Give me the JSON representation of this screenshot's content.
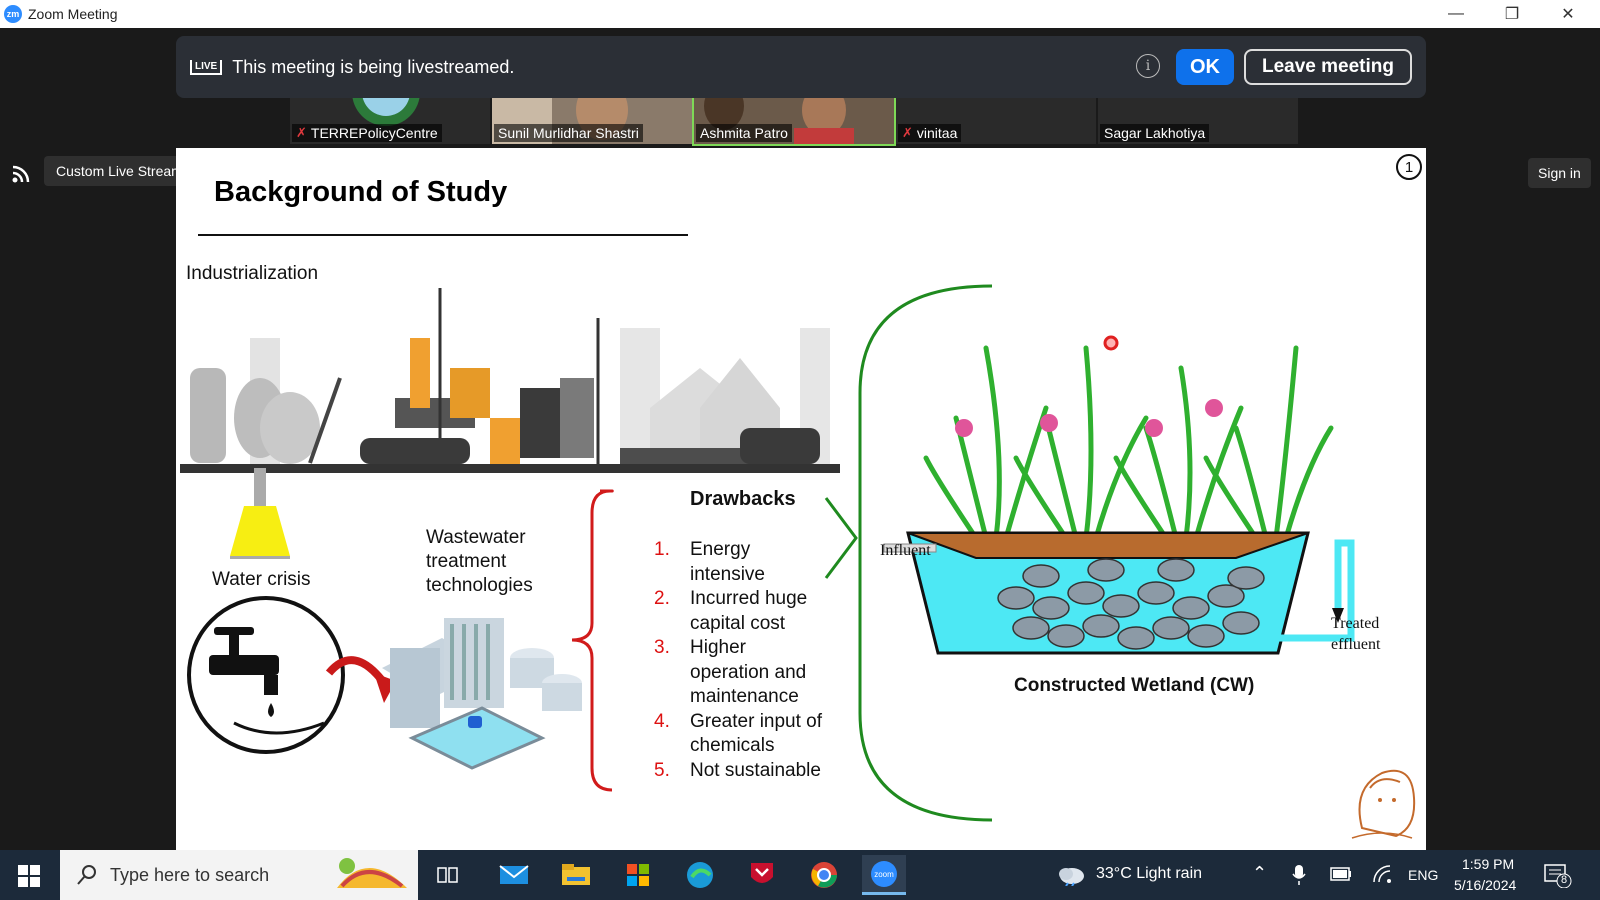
{
  "window": {
    "logo": "zm",
    "title": "Zoom Meeting",
    "controls": [
      "minimize-icon",
      "restore-icon",
      "close-icon"
    ]
  },
  "banner": {
    "live_badge": "LIVE",
    "text": "This meeting is being livestreamed.",
    "ok_label": "OK",
    "leave_label": "Leave meeting"
  },
  "participants": [
    {
      "name": "TERREPolicyCentre",
      "muted": true
    },
    {
      "name": "Sunil Murlidhar Shastri",
      "muted": false
    },
    {
      "name": "Ashmita Patro",
      "muted": false,
      "active": true
    },
    {
      "name": "vinitaa",
      "muted": true
    },
    {
      "name": "Sagar Lakhotiya",
      "muted": false
    }
  ],
  "streaming": {
    "label": "Custom Live Streaming Service",
    "sign_in": "Sign in"
  },
  "slide": {
    "number": "1",
    "title": "Background of Study",
    "industrialization": "Industrialization",
    "water_crisis": "Water crisis",
    "wastewater": [
      "Wastewater",
      "treatment",
      "technologies"
    ],
    "drawbacks_title": "Drawbacks",
    "drawbacks": [
      {
        "num": "1.",
        "lines": [
          "Energy",
          "intensive"
        ]
      },
      {
        "num": "2.",
        "lines": [
          "Incurred huge",
          "capital cost"
        ]
      },
      {
        "num": "3.",
        "lines": [
          "Higher",
          "operation and",
          "maintenance"
        ]
      },
      {
        "num": "4.",
        "lines": [
          "Greater input of",
          "chemicals"
        ]
      },
      {
        "num": "5.",
        "lines": [
          "Not sustainable"
        ]
      }
    ],
    "influent": "Influent",
    "treated": [
      "Treated",
      "effluent"
    ],
    "cw_label": "Constructed Wetland (CW)",
    "colors": {
      "bracket_red": "#d11b1b",
      "bracket_green": "#1f8a1f",
      "water": "#4de8f4",
      "plant": "#2fb02f",
      "flower": "#e0559a"
    }
  },
  "taskbar": {
    "search_placeholder": "Type here to search",
    "weather": "33°C  Light rain",
    "language": "ENG",
    "time": "1:59 PM",
    "date": "5/16/2024",
    "notifications": "8"
  }
}
